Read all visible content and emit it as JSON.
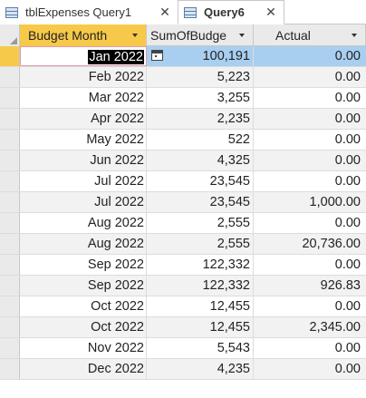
{
  "tabs": [
    {
      "label": "tblExpenses Query1",
      "close": "✕"
    },
    {
      "label": "Query6",
      "close": "✕"
    }
  ],
  "columns": [
    "Budget Month",
    "SumOfBudge",
    "Actual"
  ],
  "rows": [
    {
      "month": "Jan 2022",
      "budget": "100,191",
      "actual": "0.00"
    },
    {
      "month": "Feb 2022",
      "budget": "5,223",
      "actual": "0.00"
    },
    {
      "month": "Mar 2022",
      "budget": "3,255",
      "actual": "0.00"
    },
    {
      "month": "Apr 2022",
      "budget": "2,235",
      "actual": "0.00"
    },
    {
      "month": "May 2022",
      "budget": "522",
      "actual": "0.00"
    },
    {
      "month": "Jun 2022",
      "budget": "4,325",
      "actual": "0.00"
    },
    {
      "month": "Jul 2022",
      "budget": "23,545",
      "actual": "0.00"
    },
    {
      "month": "Jul 2022",
      "budget": "23,545",
      "actual": "1,000.00"
    },
    {
      "month": "Aug 2022",
      "budget": "2,555",
      "actual": "0.00"
    },
    {
      "month": "Aug 2022",
      "budget": "2,555",
      "actual": "20,736.00"
    },
    {
      "month": "Sep 2022",
      "budget": "122,332",
      "actual": "0.00"
    },
    {
      "month": "Sep 2022",
      "budget": "122,332",
      "actual": "926.83"
    },
    {
      "month": "Oct 2022",
      "budget": "12,455",
      "actual": "0.00"
    },
    {
      "month": "Oct 2022",
      "budget": "12,455",
      "actual": "2,345.00"
    },
    {
      "month": "Nov 2022",
      "budget": "5,543",
      "actual": "0.00"
    },
    {
      "month": "Dec 2022",
      "budget": "4,235",
      "actual": "0.00"
    }
  ]
}
